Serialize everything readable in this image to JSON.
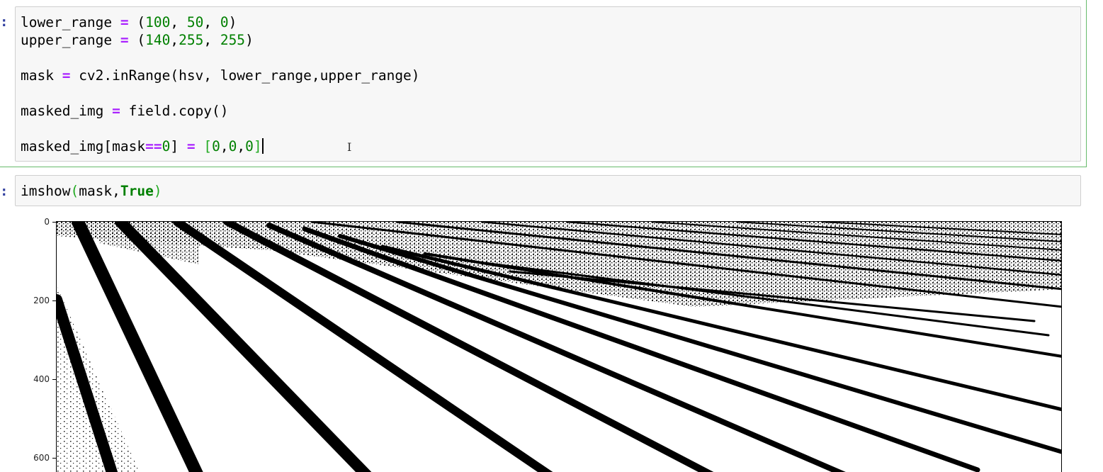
{
  "cells": [
    {
      "prompt": ":",
      "lines": [
        "lower_range = (100, 50, 0)",
        "upper_range = (140,255, 255)",
        "",
        "mask = cv2.inRange(hsv, lower_range,upper_range)",
        "",
        "masked_img = field.copy()",
        "",
        "masked_img[mask==0] = [0,0,0]"
      ]
    },
    {
      "prompt": ":",
      "code": "imshow(mask,True)"
    }
  ],
  "output_image": {
    "y_ticks": [
      "0",
      "200",
      "400",
      "600"
    ],
    "description_icon": "binary-mask-image"
  },
  "colors": {
    "selected_border": "#66bb6a",
    "input_bg": "#f7f7f7",
    "operator": "#aa22ff",
    "number": "#008000"
  }
}
